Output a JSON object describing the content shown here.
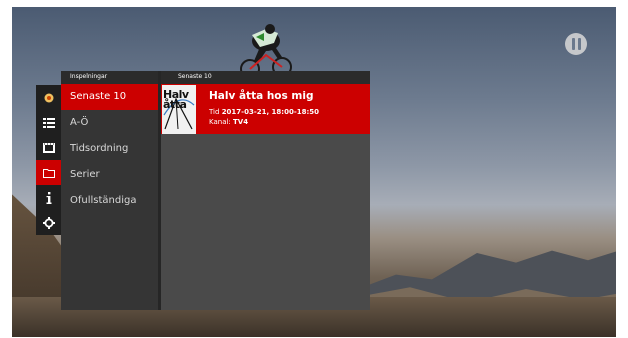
{
  "background": {
    "sky_color": "#6d7b8f",
    "ground_color": "#6a5a48"
  },
  "brand_logo_icon": "channel-logo-icon",
  "header": {
    "left_label": "Inspelningar",
    "right_label": "Senaste 10"
  },
  "rail": {
    "items": [
      {
        "icon": "gear-star-icon"
      },
      {
        "icon": "grid-icon"
      },
      {
        "icon": "film-icon"
      },
      {
        "icon": "folder-icon",
        "active": true
      },
      {
        "icon": "info-icon"
      },
      {
        "icon": "settings-icon"
      }
    ]
  },
  "menu": {
    "items": [
      {
        "label": "Senaste 10",
        "active": true
      },
      {
        "label": "A-Ö"
      },
      {
        "label": "Tidsordning"
      },
      {
        "label": "Serier"
      },
      {
        "label": "Ofullständiga"
      }
    ]
  },
  "recording": {
    "title": "Halv åtta hos mig",
    "thumb_text": "Halv\nåtta",
    "time_label": "Tid",
    "time_value": "2017-03-21, 18:00-18:50",
    "channel_label": "Kanal:",
    "channel_value": "TV4"
  },
  "colors": {
    "accent": "#cc0000",
    "panel_dark": "#353535",
    "panel_content": "#4a4a4a",
    "rail": "#1f1f1f"
  }
}
